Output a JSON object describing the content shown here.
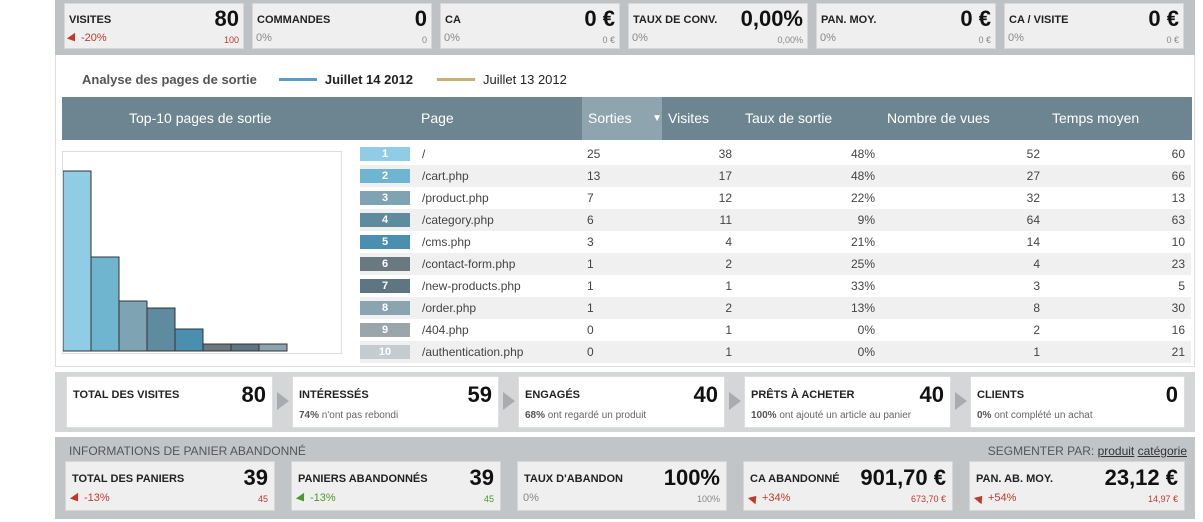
{
  "kpis": [
    {
      "label": "VISITES",
      "value": "80",
      "change": "-20%",
      "compare": "100",
      "dir": "down"
    },
    {
      "label": "COMMANDES",
      "value": "0",
      "change": "0%",
      "compare": "0",
      "dir": "none"
    },
    {
      "label": "CA",
      "value": "0 €",
      "change": "0%",
      "compare": "0 €",
      "dir": "none"
    },
    {
      "label": "TAUX DE CONV.",
      "value": "0,00%",
      "change": "0%",
      "compare": "0,00%",
      "dir": "none"
    },
    {
      "label": "PAN. MOY.",
      "value": "0 €",
      "change": "0%",
      "compare": "0 €",
      "dir": "none"
    },
    {
      "label": "CA / VISITE",
      "value": "0 €",
      "change": "0%",
      "compare": "0 €",
      "dir": "none"
    }
  ],
  "legend": {
    "title": "Analyse des pages de sortie",
    "series1": "Juillet 14 2012",
    "series2": "Juillet 13 2012",
    "series1_color": "#5b9bc8",
    "series2_color": "#c9b07a"
  },
  "table": {
    "chart_title": "Top-10 pages de sortie",
    "headers": [
      "Page",
      "Sorties",
      "Visites",
      "Taux de sortie",
      "Nombre de vues",
      "Temps moyen"
    ],
    "sort_icon": "▼",
    "rows": [
      {
        "rank": "1",
        "page": "/",
        "sorties": "25",
        "visites": "38",
        "taux": "48%",
        "vues": "52",
        "temps": "60",
        "color": "#91cce6"
      },
      {
        "rank": "2",
        "page": "/cart.php",
        "sorties": "13",
        "visites": "17",
        "taux": "48%",
        "vues": "27",
        "temps": "66",
        "color": "#6fb5d0"
      },
      {
        "rank": "3",
        "page": "/product.php",
        "sorties": "7",
        "visites": "12",
        "taux": "22%",
        "vues": "32",
        "temps": "13",
        "color": "#7ea3b2"
      },
      {
        "rank": "4",
        "page": "/category.php",
        "sorties": "6",
        "visites": "11",
        "taux": "9%",
        "vues": "64",
        "temps": "63",
        "color": "#5e8b9e"
      },
      {
        "rank": "5",
        "page": "/cms.php",
        "sorties": "3",
        "visites": "4",
        "taux": "21%",
        "vues": "14",
        "temps": "10",
        "color": "#4a8fb0"
      },
      {
        "rank": "6",
        "page": "/contact-form.php",
        "sorties": "1",
        "visites": "2",
        "taux": "25%",
        "vues": "4",
        "temps": "23",
        "color": "#6a7880"
      },
      {
        "rank": "7",
        "page": "/new-products.php",
        "sorties": "1",
        "visites": "1",
        "taux": "33%",
        "vues": "3",
        "temps": "5",
        "color": "#5d7682"
      },
      {
        "rank": "8",
        "page": "/order.php",
        "sorties": "1",
        "visites": "2",
        "taux": "13%",
        "vues": "8",
        "temps": "30",
        "color": "#8aa4b0"
      },
      {
        "rank": "9",
        "page": "/404.php",
        "sorties": "0",
        "visites": "1",
        "taux": "0%",
        "vues": "2",
        "temps": "16",
        "color": "#9ba6ab"
      },
      {
        "rank": "10",
        "page": "/authentication.php",
        "sorties": "0",
        "visites": "1",
        "taux": "0%",
        "vues": "1",
        "temps": "21",
        "color": "#c4ccd0"
      }
    ]
  },
  "chart_data": {
    "type": "bar",
    "categories": [
      "1",
      "2",
      "3",
      "4",
      "5",
      "6",
      "7",
      "8",
      "9",
      "10"
    ],
    "values": [
      25,
      13,
      7,
      6,
      3,
      1,
      1,
      1,
      0,
      0
    ],
    "colors": [
      "#91cce6",
      "#6fb5d0",
      "#7ea3b2",
      "#5e8b9e",
      "#4a8fb0",
      "#6a7880",
      "#5d7682",
      "#8aa4b0",
      "#9ba6ab",
      "#c4ccd0"
    ],
    "title": "Top-10 pages de sortie",
    "ylim": [
      0,
      25
    ],
    "grid": false
  },
  "funnel": [
    {
      "label": "TOTAL DES VISITES",
      "value": "80",
      "pct": "",
      "text": ""
    },
    {
      "label": "INTÉRESSÉS",
      "value": "59",
      "pct": "74%",
      "text": "n'ont pas rebondi"
    },
    {
      "label": "ENGAGÉS",
      "value": "40",
      "pct": "68%",
      "text": "ont regardé un produit"
    },
    {
      "label": "PRÊTS À ACHETER",
      "value": "40",
      "pct": "100%",
      "text": "ont ajouté un article au panier"
    },
    {
      "label": "CLIENTS",
      "value": "0",
      "pct": "0%",
      "text": "ont complété un achat"
    }
  ],
  "cart": {
    "title": "INFORMATIONS DE PANIER ABANDONNÉ",
    "segment_label": "SEGMENTER PAR:",
    "segment_links": [
      "produit",
      "catégorie"
    ],
    "boxes": [
      {
        "label": "TOTAL DES PANIERS",
        "value": "39",
        "change": "-13%",
        "compare": "45",
        "style": "red-down"
      },
      {
        "label": "PANIERS ABANDONNÉS",
        "value": "39",
        "change": "-13%",
        "compare": "45",
        "style": "green-down"
      },
      {
        "label": "TAUX D'ABANDON",
        "value": "100%",
        "change": "0%",
        "compare": "100%",
        "style": "none"
      },
      {
        "label": "CA ABANDONNÉ",
        "value": "901,70 €",
        "change": "+34%",
        "compare": "673,70 €",
        "style": "red-up"
      },
      {
        "label": "PAN. AB. MOY.",
        "value": "23,12 €",
        "change": "+54%",
        "compare": "14,97 €",
        "style": "red-up"
      }
    ]
  }
}
